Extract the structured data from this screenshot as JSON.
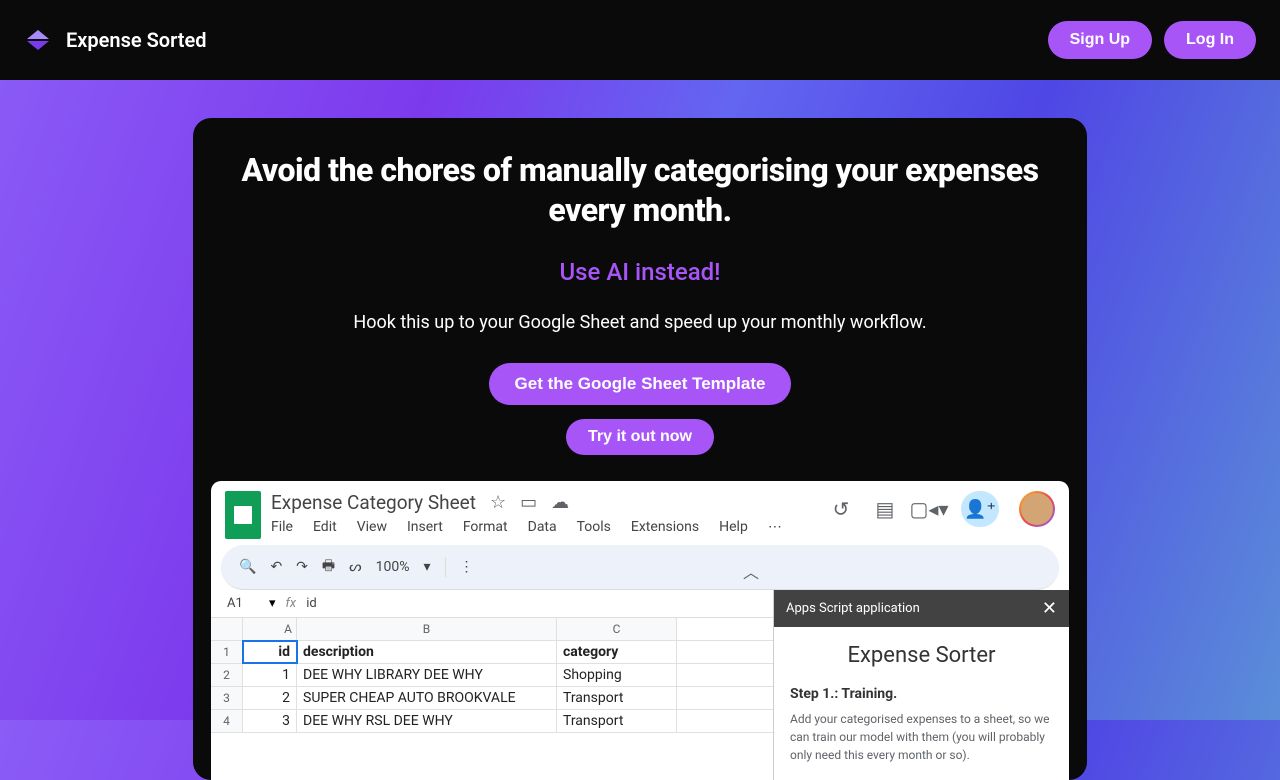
{
  "nav": {
    "brand": "Expense Sorted",
    "signup": "Sign Up",
    "login": "Log In"
  },
  "hero": {
    "title": "Avoid the chores of manually categorising your expenses every month.",
    "subtitle": "Use AI instead!",
    "description": "Hook this up to your Google Sheet and speed up your monthly workflow.",
    "cta1": "Get the Google Sheet Template",
    "cta2": "Try it out now"
  },
  "mockup": {
    "doc_title": "Expense Category Sheet",
    "menu": [
      "File",
      "Edit",
      "View",
      "Insert",
      "Format",
      "Data",
      "Tools",
      "Extensions",
      "Help"
    ],
    "zoom": "100%",
    "cell_ref": "A1",
    "formula_value": "id",
    "columns": [
      "A",
      "B",
      "C"
    ],
    "headers": {
      "id": "id",
      "description": "description",
      "category": "category"
    },
    "rows": [
      {
        "n": "2",
        "id": "1",
        "desc": "DEE WHY LIBRARY DEE WHY",
        "cat": "Shopping"
      },
      {
        "n": "3",
        "id": "2",
        "desc": "SUPER CHEAP AUTO BROOKVALE",
        "cat": "Transport"
      },
      {
        "n": "4",
        "id": "3",
        "desc": "DEE WHY RSL DEE WHY",
        "cat": "Transport"
      }
    ],
    "panel": {
      "header": "Apps Script application",
      "title": "Expense Sorter",
      "step": "Step 1.: Training.",
      "desc": "Add your categorised expenses to a sheet, so we can train our model with them (you will probably only need this every month or so)."
    }
  }
}
